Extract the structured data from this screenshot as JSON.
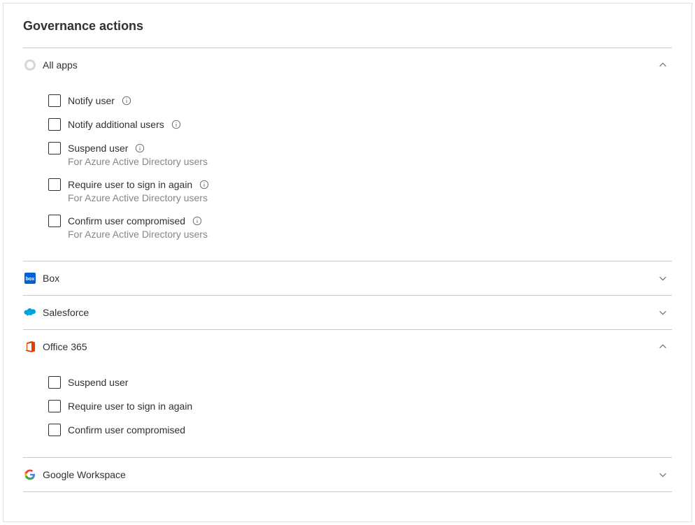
{
  "title": "Governance actions",
  "sections": [
    {
      "id": "all-apps",
      "title": "All apps",
      "expanded": true,
      "icon": "allapps",
      "options": [
        {
          "id": "notify-user",
          "label": "Notify user",
          "info": true
        },
        {
          "id": "notify-additional",
          "label": "Notify additional users",
          "info": true
        },
        {
          "id": "suspend-user",
          "label": "Suspend user",
          "info": true,
          "subtext": "For Azure Active Directory users"
        },
        {
          "id": "require-signin",
          "label": "Require user to sign in again",
          "info": true,
          "subtext": "For Azure Active Directory users"
        },
        {
          "id": "confirm-compromised",
          "label": "Confirm user compromised",
          "info": true,
          "subtext": "For Azure Active Directory users"
        }
      ]
    },
    {
      "id": "box",
      "title": "Box",
      "expanded": false,
      "icon": "box"
    },
    {
      "id": "salesforce",
      "title": "Salesforce",
      "expanded": false,
      "icon": "salesforce"
    },
    {
      "id": "office365",
      "title": "Office 365",
      "expanded": true,
      "icon": "office365",
      "options": [
        {
          "id": "o365-suspend",
          "label": "Suspend user"
        },
        {
          "id": "o365-require-signin",
          "label": "Require user to sign in again"
        },
        {
          "id": "o365-confirm-compromised",
          "label": "Confirm user compromised"
        }
      ]
    },
    {
      "id": "google-workspace",
      "title": "Google Workspace",
      "expanded": false,
      "icon": "google"
    }
  ]
}
